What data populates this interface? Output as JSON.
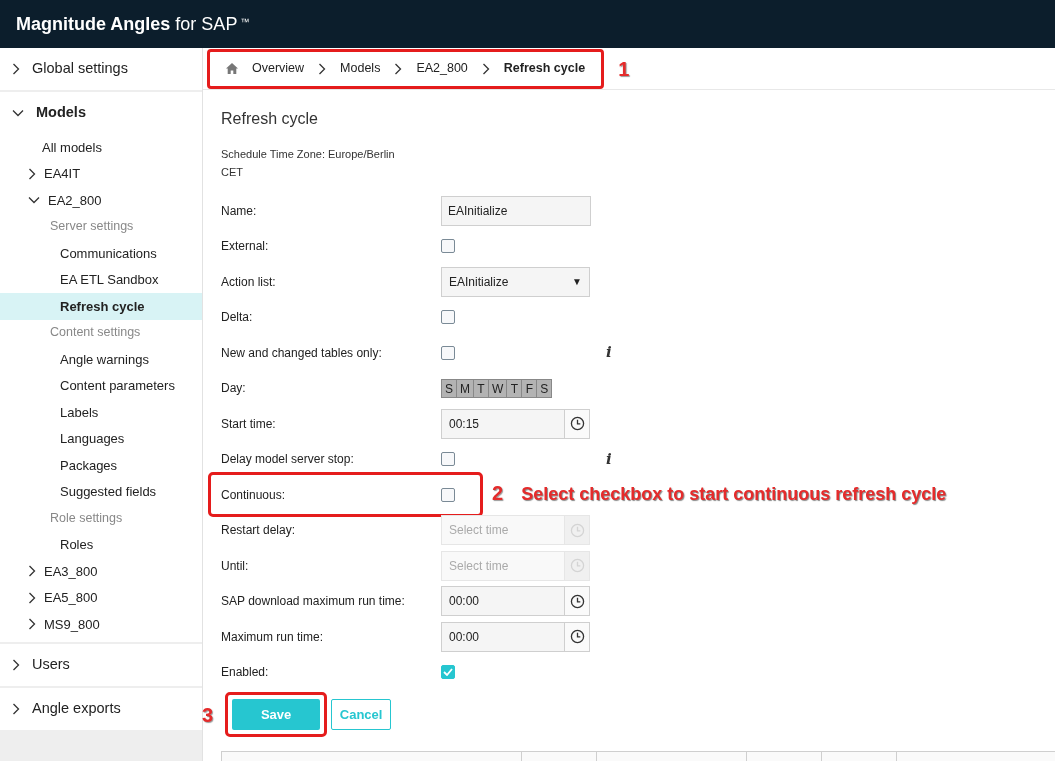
{
  "app_title": {
    "name": "Magnitude Angles",
    "suffix": "for SAP",
    "mark": "™"
  },
  "sidebar": {
    "sections": [
      {
        "label": "Global settings",
        "expanded": false
      },
      {
        "label": "Models",
        "expanded": true,
        "children": [
          {
            "kind": "page",
            "label": "All models",
            "selected": false
          },
          {
            "kind": "model",
            "label": "EA4IT",
            "expanded": false
          },
          {
            "kind": "model",
            "label": "EA2_800",
            "expanded": true,
            "children": [
              {
                "kind": "group",
                "label": "Server settings"
              },
              {
                "kind": "page",
                "label": "Communications",
                "selected": false
              },
              {
                "kind": "page",
                "label": "EA ETL Sandbox",
                "selected": false
              },
              {
                "kind": "page",
                "label": "Refresh cycle",
                "selected": true
              },
              {
                "kind": "group",
                "label": "Content settings"
              },
              {
                "kind": "page",
                "label": "Angle warnings",
                "selected": false
              },
              {
                "kind": "page",
                "label": "Content parameters",
                "selected": false
              },
              {
                "kind": "page",
                "label": "Labels",
                "selected": false
              },
              {
                "kind": "page",
                "label": "Languages",
                "selected": false
              },
              {
                "kind": "page",
                "label": "Packages",
                "selected": false
              },
              {
                "kind": "page",
                "label": "Suggested fields",
                "selected": false
              },
              {
                "kind": "group",
                "label": "Role settings"
              },
              {
                "kind": "page",
                "label": "Roles",
                "selected": false
              }
            ]
          },
          {
            "kind": "model",
            "label": "EA3_800",
            "expanded": false
          },
          {
            "kind": "model",
            "label": "EA5_800",
            "expanded": false
          },
          {
            "kind": "model",
            "label": "MS9_800",
            "expanded": false
          }
        ]
      },
      {
        "label": "Users",
        "expanded": false
      },
      {
        "label": "Angle exports",
        "expanded": false
      }
    ]
  },
  "breadcrumb": {
    "callout": "1",
    "items": [
      "Overview",
      "Models",
      "EA2_800",
      "Refresh cycle"
    ]
  },
  "page_title": "Refresh cycle",
  "timezone": [
    "Schedule Time Zone: Europe/Berlin",
    "CET"
  ],
  "form_rows": [
    {
      "kind": "text",
      "label": "Name:",
      "value": "EAInitialize"
    },
    {
      "kind": "checkbox",
      "label": "External:",
      "checked": false
    },
    {
      "kind": "select",
      "label": "Action list:",
      "value": "EAInitialize",
      "caret": "▼"
    },
    {
      "kind": "checkbox",
      "label": "Delta:",
      "checked": false
    },
    {
      "kind": "checkbox",
      "label": "New and changed tables only:",
      "checked": false,
      "info": "i"
    },
    {
      "kind": "days",
      "label": "Day:",
      "days": [
        {
          "label": "S",
          "selected": false
        },
        {
          "label": "M",
          "selected": false
        },
        {
          "label": "T",
          "selected": false
        },
        {
          "label": "W",
          "selected": false
        },
        {
          "label": "T",
          "selected": false
        },
        {
          "label": "F",
          "selected": false
        },
        {
          "label": "S",
          "selected": false
        }
      ]
    },
    {
      "kind": "time",
      "label": "Start time:",
      "value": "00:15",
      "disabled": false
    },
    {
      "kind": "checkbox",
      "label": "Delay model server stop:",
      "checked": false,
      "info": "i"
    },
    {
      "kind": "checkbox",
      "label": "Continuous:",
      "checked": false,
      "callout": "2",
      "note": "Select checkbox to start continuous refresh cycle"
    },
    {
      "kind": "time",
      "label": "Restart delay:",
      "placeholder": "Select time",
      "disabled": true
    },
    {
      "kind": "time",
      "label": "Until:",
      "placeholder": "Select time",
      "disabled": true
    },
    {
      "kind": "time",
      "label": "SAP download maximum run time:",
      "value": "00:00",
      "disabled": false
    },
    {
      "kind": "time",
      "label": "Maximum run time:",
      "value": "00:00",
      "disabled": false
    },
    {
      "kind": "checkbox",
      "label": "Enabled:",
      "checked": true
    }
  ],
  "buttons": [
    {
      "kind": "primary",
      "label": "Save",
      "callout": "3"
    },
    {
      "kind": "secondary",
      "label": "Cancel"
    }
  ]
}
